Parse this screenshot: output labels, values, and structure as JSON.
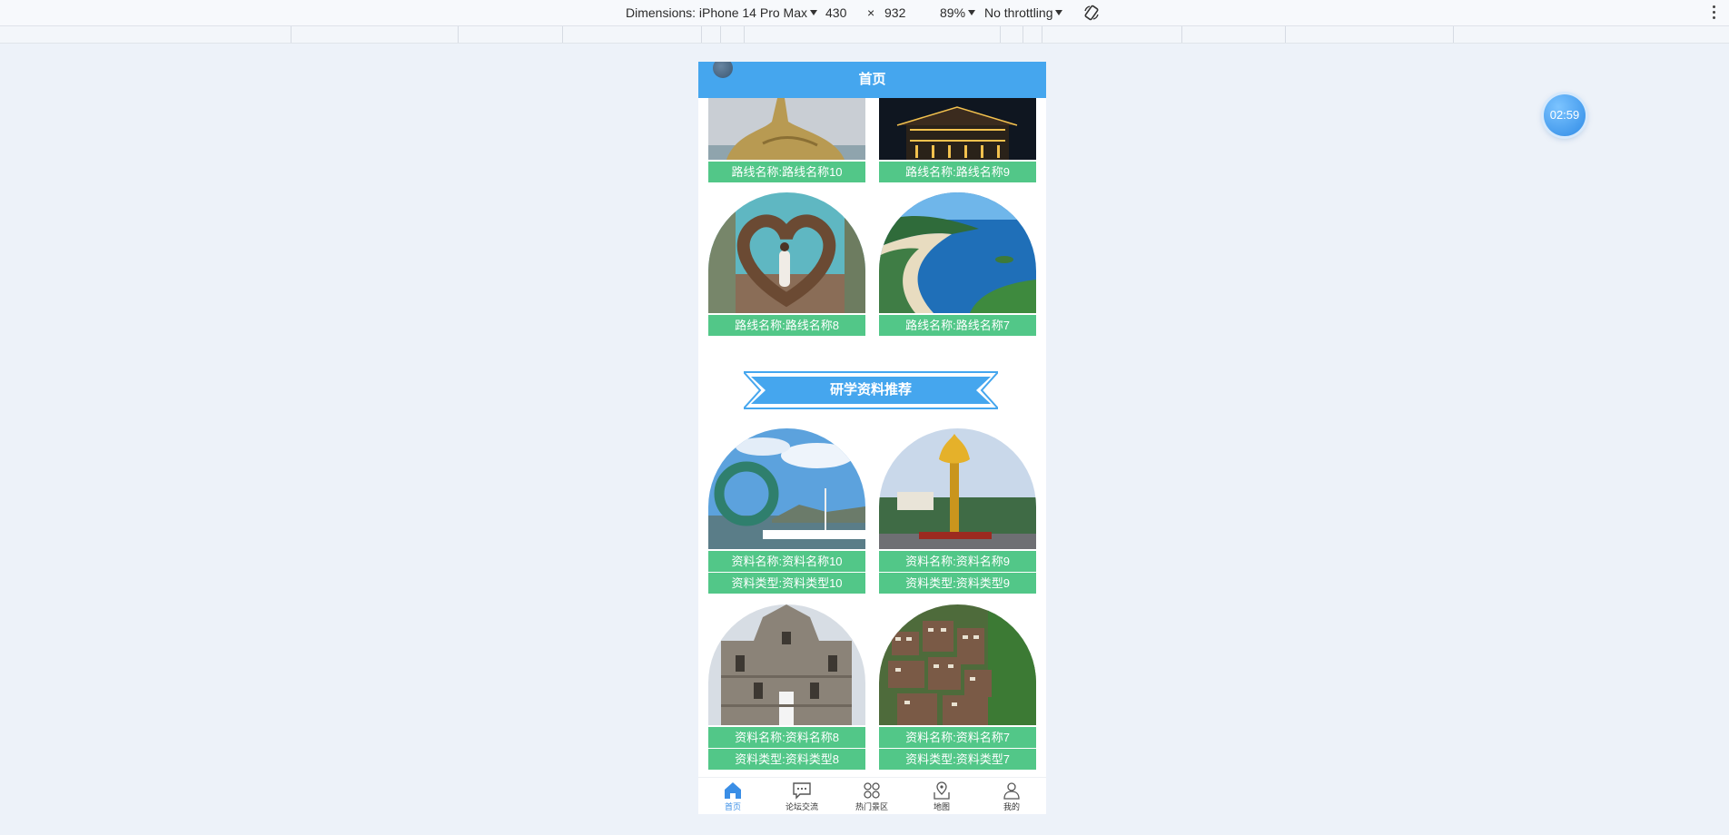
{
  "devtools": {
    "dimensions_label": "Dimensions: iPhone 14 Pro Max",
    "width": "430",
    "times": "×",
    "height": "932",
    "zoom": "89%",
    "throttling": "No throttling",
    "rotate_icon": "rotate-device-icon",
    "menu_icon": "more-vertical-icon"
  },
  "header": {
    "title": "首页"
  },
  "routes": [
    {
      "label": "路线名称:路线名称10",
      "scene": "statue"
    },
    {
      "label": "路线名称:路线名称9",
      "scene": "night-temple"
    },
    {
      "label": "路线名称:路线名称8",
      "scene": "heart-nest"
    },
    {
      "label": "路线名称:路线名称7",
      "scene": "bay"
    }
  ],
  "section": {
    "title": "研学资料推荐"
  },
  "materials": [
    {
      "name": "资料名称:资料名称10",
      "type": "资料类型:资料类型10",
      "scene": "ring-sculpture"
    },
    {
      "name": "资料名称:资料名称9",
      "type": "资料类型:资料类型9",
      "scene": "golden-lotus"
    },
    {
      "name": "资料名称:资料名称8",
      "type": "资料类型:资料类型8",
      "scene": "ruins-facade"
    },
    {
      "name": "资料名称:资料名称7",
      "type": "资料类型:资料类型7",
      "scene": "hill-town"
    }
  ],
  "tabbar": [
    {
      "label": "首页",
      "icon": "home-icon",
      "active": true
    },
    {
      "label": "论坛交流",
      "icon": "chat-icon",
      "active": false
    },
    {
      "label": "热门景区",
      "icon": "grid-icon",
      "active": false
    },
    {
      "label": "地图",
      "icon": "map-pin-icon",
      "active": false
    },
    {
      "label": "我的",
      "icon": "user-icon",
      "active": false
    }
  ],
  "timer": {
    "text": "02:59"
  },
  "colors": {
    "navbar": "#45a6ee",
    "label_green": "#52c788",
    "banner_blue": "#45a6ee",
    "tab_active": "#3a8ee6",
    "page_bg": "#edf2f9"
  }
}
